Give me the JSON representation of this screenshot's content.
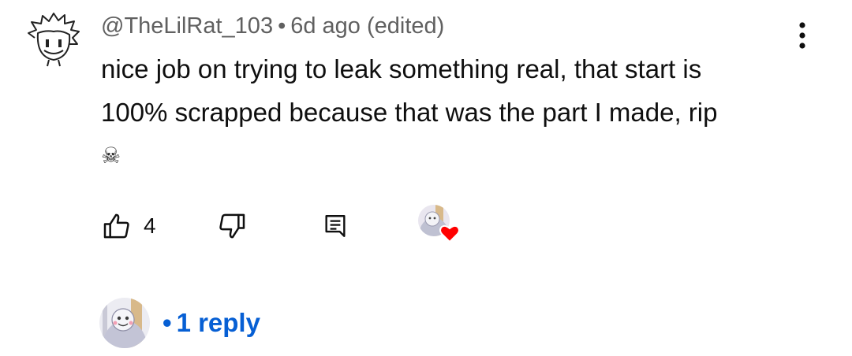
{
  "comment": {
    "author": "@TheLilRat_103",
    "separator": "•",
    "time": "6d ago (edited)",
    "text_lines": [
      "nice job on trying to leak something real, that start is",
      "100% scrapped because that was the part I made, rip"
    ],
    "emoji": "☠"
  },
  "actions": {
    "like_count": "4",
    "like_icon": "thumbs-up-icon",
    "dislike_icon": "thumbs-down-icon",
    "reply_icon": "comment-icon",
    "creator_heart_icon": "creator-heart-icon"
  },
  "replies": {
    "dot": "•",
    "label": "1 reply",
    "link_color": "#065fd4"
  },
  "colors": {
    "text": "#0f0f0f",
    "meta": "#606060",
    "heart": "#ff0000"
  }
}
